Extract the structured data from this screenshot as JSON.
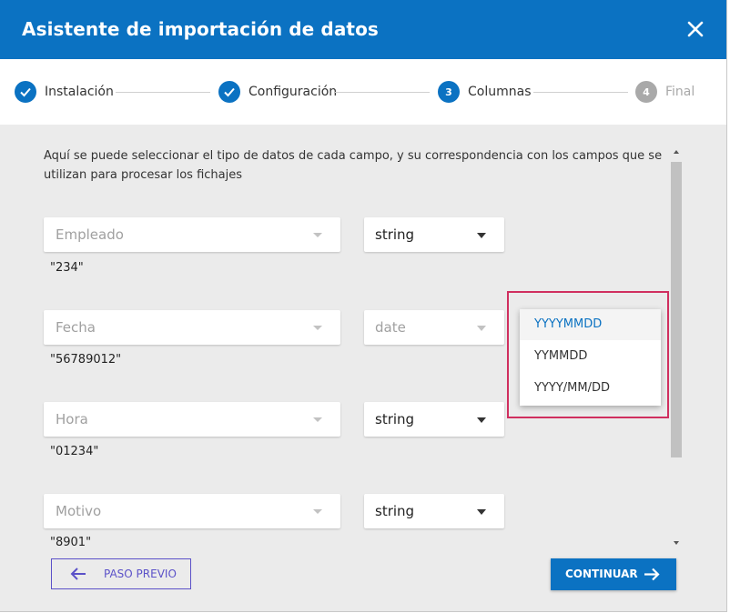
{
  "dialog": {
    "title": "Asistente de importación de datos"
  },
  "stepper": {
    "steps": [
      {
        "label": "Instalación",
        "state": "done"
      },
      {
        "label": "Configuración",
        "state": "done"
      },
      {
        "number": "3",
        "label": "Columnas",
        "state": "active"
      },
      {
        "number": "4",
        "label": "Final",
        "state": "pending"
      }
    ]
  },
  "content": {
    "description": "Aquí se puede seleccionar el tipo de datos de cada campo, y su correspondencia con los campos que se utilizan para procesar los fichajes",
    "rows": [
      {
        "field_placeholder": "Empleado",
        "type": "string",
        "sample": "\"234\""
      },
      {
        "field_placeholder": "Fecha",
        "type": "date",
        "sample": "\"56789012\""
      },
      {
        "field_placeholder": "Hora",
        "type": "string",
        "sample": "\"01234\""
      },
      {
        "field_placeholder": "Motivo",
        "type": "string",
        "sample": "\"8901\""
      }
    ],
    "date_format_menu": {
      "options": [
        "YYYYMMDD",
        "YYMMDD",
        "YYYY/MM/DD"
      ],
      "selected": "YYYYMMDD"
    }
  },
  "footer": {
    "prev_label": "PASO PREVIO",
    "next_label": "CONTINUAR"
  },
  "colors": {
    "primary": "#0b72c2",
    "pending": "#a9a9a9",
    "highlight": "#d02f5f",
    "prev_button": "#5b51c8"
  }
}
